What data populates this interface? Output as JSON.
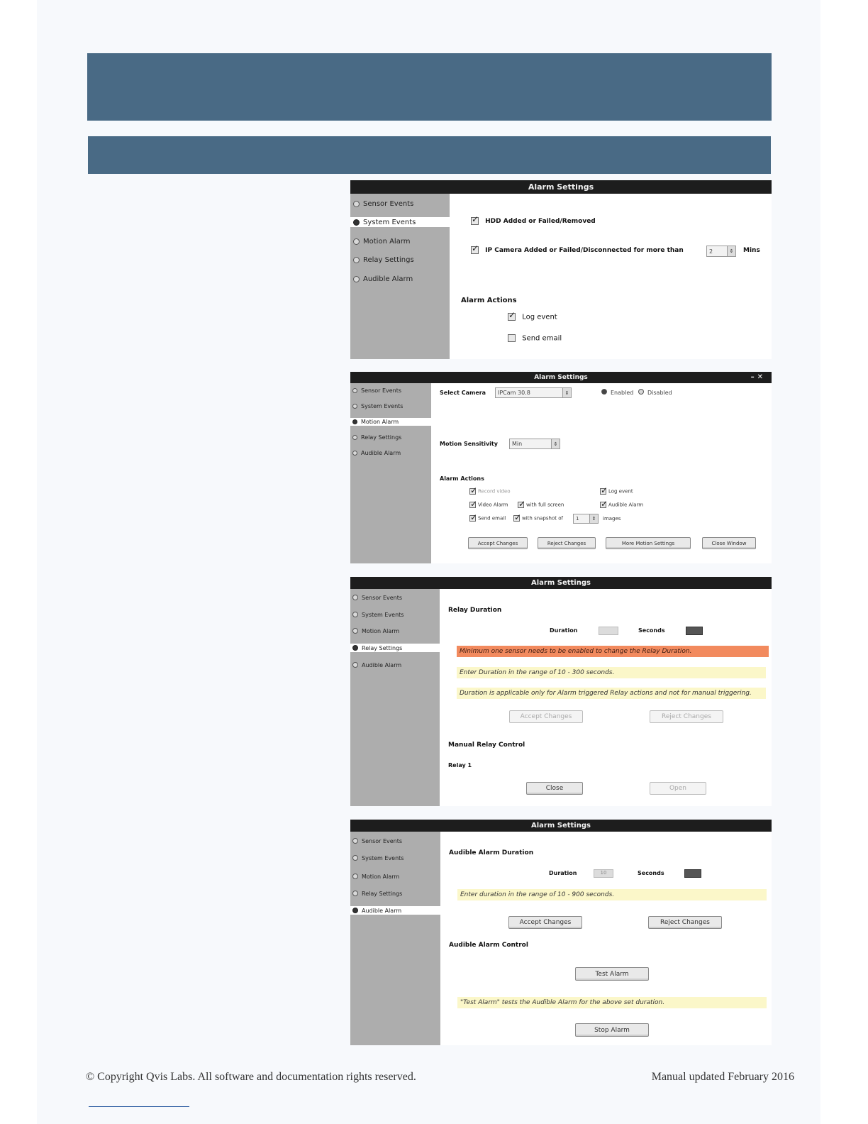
{
  "page": {
    "footer_left": "© Copyright Qvis Labs. All software and documentation rights reserved.",
    "footer_right": "Manual updated February 2016"
  },
  "colors": {
    "banner": "#496a85",
    "titlebar": "#1d1d1d",
    "sidebar": "#adadad",
    "note_yellow": "#fbf7c9",
    "note_orange": "#f28a5e"
  },
  "sidebar_items": {
    "sensor_events": "Sensor Events",
    "system_events": "System Events",
    "motion_alarm": "Motion Alarm",
    "relay_settings": "Relay Settings",
    "audible_alarm": "Audible Alarm"
  },
  "shot1": {
    "title": "Alarm Settings",
    "hdd_label": "HDD Added or Failed/Removed",
    "ipcam_label": "IP Camera Added or Failed/Disconnected for more than",
    "ipcam_value": "2",
    "ipcam_unit": "Mins",
    "alarm_actions": "Alarm Actions",
    "log_event": "Log event",
    "send_email": "Send email"
  },
  "shot2": {
    "title": "Alarm Settings",
    "select_camera": "Select Camera",
    "camera_value": "IPCam 30.8",
    "enabled": "Enabled",
    "disabled": "Disabled",
    "motion_sensitivity": "Motion Sensitivity",
    "sensitivity_value": "Min",
    "alarm_actions": "Alarm Actions",
    "record_video": "Record video",
    "log_event": "Log event",
    "video_alarm": "Video Alarm",
    "with_full_screen": "with full screen",
    "audible_alarm": "Audible Alarm",
    "send_email": "Send email",
    "with_snapshot_of": "with snapshot of",
    "snapshot_value": "1",
    "images": "images",
    "accept_changes": "Accept Changes",
    "reject_changes": "Reject Changes",
    "more_motion_settings": "More Motion Settings",
    "close_window": "Close Window"
  },
  "shot3": {
    "title": "Alarm Settings",
    "relay_duration": "Relay Duration",
    "duration": "Duration",
    "seconds": "Seconds",
    "note_orange": "Minimum one sensor needs to be enabled to change the Relay Duration.",
    "note_range": "Enter Duration in the range of 10 - 300 seconds.",
    "note_applicable": "Duration is applicable only for Alarm triggered Relay actions and not for manual triggering.",
    "accept_changes": "Accept Changes",
    "reject_changes": "Reject Changes",
    "manual_relay_control": "Manual Relay Control",
    "relay_1": "Relay 1",
    "close": "Close",
    "open": "Open"
  },
  "shot4": {
    "title": "Alarm Settings",
    "audible_alarm_duration": "Audible Alarm Duration",
    "duration": "Duration",
    "duration_value": "10",
    "seconds": "Seconds",
    "note_range": "Enter duration in the range of 10 - 900 seconds.",
    "accept_changes": "Accept Changes",
    "reject_changes": "Reject Changes",
    "audible_alarm_control": "Audible Alarm Control",
    "test_alarm": "Test Alarm",
    "note_test": "\"Test Alarm\" tests the Audible Alarm for the above set duration.",
    "stop_alarm": "Stop Alarm"
  }
}
